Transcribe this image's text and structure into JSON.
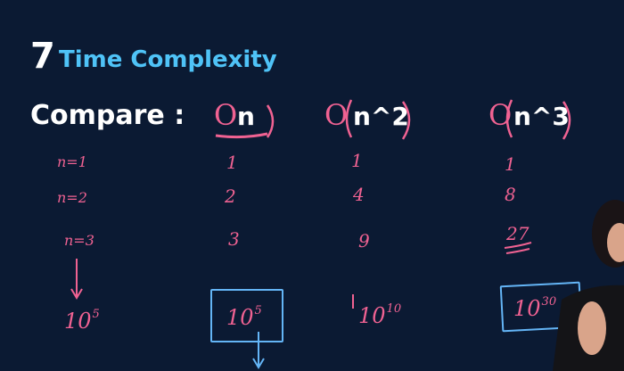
{
  "header": {
    "number": "7",
    "title": "Time Complexity"
  },
  "compare_label": "Compare :",
  "columns": [
    {
      "big_o": "O",
      "arg": "n"
    },
    {
      "big_o": "O",
      "arg": "n^2"
    },
    {
      "big_o": "O",
      "arg": "n^3"
    }
  ],
  "rows": [
    {
      "label": "n=1",
      "values": [
        "1",
        "1",
        "1"
      ]
    },
    {
      "label": "n=2",
      "values": [
        "2",
        "4",
        "8"
      ]
    },
    {
      "label": "n=3",
      "values": [
        "3",
        "9",
        "27"
      ]
    }
  ],
  "final_row": {
    "label_base": "10",
    "label_exp": "5",
    "values": [
      {
        "base": "10",
        "exp": "5"
      },
      {
        "base": "10",
        "exp": "10"
      },
      {
        "base": "10",
        "exp": "30"
      }
    ]
  },
  "colors": {
    "background": "#0b1a33",
    "title_accent": "#4fc3f7",
    "ink_pink": "#f06292",
    "ink_blue": "#64b5f6"
  }
}
